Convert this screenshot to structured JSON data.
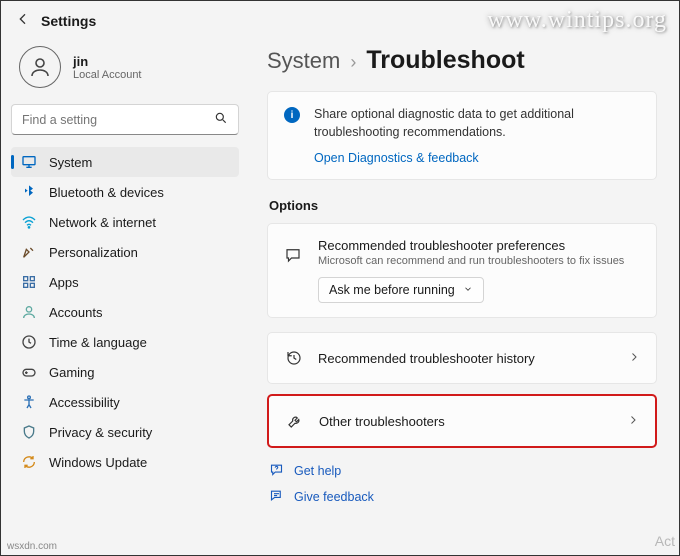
{
  "header": {
    "title": "Settings"
  },
  "account": {
    "name": "jin",
    "sub": "Local Account"
  },
  "search": {
    "placeholder": "Find a setting"
  },
  "sidebar": {
    "items": [
      {
        "label": "System"
      },
      {
        "label": "Bluetooth & devices"
      },
      {
        "label": "Network & internet"
      },
      {
        "label": "Personalization"
      },
      {
        "label": "Apps"
      },
      {
        "label": "Accounts"
      },
      {
        "label": "Time & language"
      },
      {
        "label": "Gaming"
      },
      {
        "label": "Accessibility"
      },
      {
        "label": "Privacy & security"
      },
      {
        "label": "Windows Update"
      }
    ]
  },
  "breadcrumb": {
    "parent": "System",
    "sep": "›",
    "current": "Troubleshoot"
  },
  "info": {
    "msg": "Share optional diagnostic data to get additional troubleshooting recommendations.",
    "link": "Open Diagnostics & feedback"
  },
  "options": {
    "label": "Options",
    "pref": {
      "title": "Recommended troubleshooter preferences",
      "desc": "Microsoft can recommend and run troubleshooters to fix issues",
      "dropdown": "Ask me before running"
    },
    "history": "Recommended troubleshooter history",
    "others": "Other troubleshooters"
  },
  "foot": {
    "help": "Get help",
    "feedback": "Give feedback"
  },
  "watermark": "www.wintips.org",
  "wsxdn": "wsxdn.com",
  "act": "Act"
}
